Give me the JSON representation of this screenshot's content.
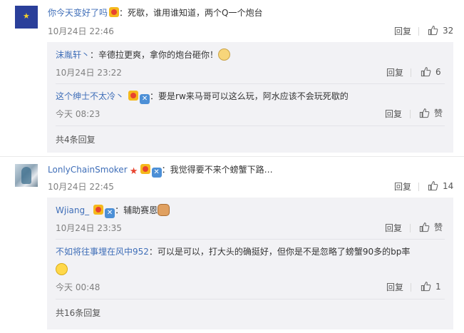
{
  "comments": [
    {
      "user": "你今天变好了吗",
      "text": "：死歇，谁用谁知道，两个Q一个炮台",
      "time": "10月24日 22:46",
      "reply_label": "回复",
      "likes": "32",
      "replies": [
        {
          "user": "沫胤轩丶",
          "text": "：辛德拉更爽，拿你的炮台砸你！",
          "time": "10月24日 23:22",
          "reply_label": "回复",
          "likes": "6"
        },
        {
          "user": "这个绅士不太冷丶",
          "text": "：要是rw来马哥可以这么玩，阿水应该不会玩死歇的",
          "time": "今天 08:23",
          "reply_label": "回复",
          "likes": "赞"
        }
      ],
      "more_label": "共4条回复"
    },
    {
      "user": "LonlyChainSmoker",
      "text": "：我觉得要不来个螃蟹下路…",
      "time": "10月24日 22:45",
      "reply_label": "回复",
      "likes": "14",
      "replies": [
        {
          "user": "Wjiang_",
          "text": "：辅助赛恩",
          "time": "10月24日 23:35",
          "reply_label": "回复",
          "likes": "赞"
        },
        {
          "user": "不如将往事埋在风中952",
          "text": "：可以是可以，打大头的确挺好，但你是不是忽略了螃蟹90多的bp率",
          "time": "今天 00:48",
          "reply_label": "回复",
          "likes": "1"
        }
      ],
      "more_label": "共16条回复"
    }
  ],
  "colors": {
    "username": "#3f6eb8",
    "reply_bg": "#f2f2f5",
    "meta": "#808080"
  },
  "icons": [
    "thumbs-up-icon",
    "vip-badge-icon",
    "cross-badge-icon",
    "star-badge-icon"
  ]
}
